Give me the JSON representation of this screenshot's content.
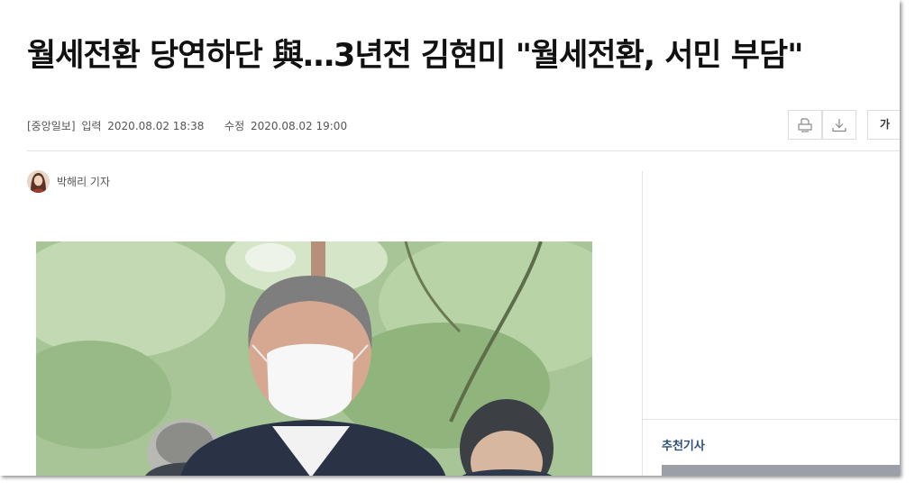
{
  "article": {
    "headline": "월세전환 당연하단 與…3년전 김현미 \"월세전환, 서민 부담\"",
    "source": "[중앙일보]",
    "input_label": "입력",
    "input_time": "2020.08.02 18:38",
    "edit_label": "수정",
    "edit_time": "2020.08.02 19:00",
    "reporter": "박해리 기자"
  },
  "toolbar": {
    "print_icon": "print-icon",
    "download_icon": "download-icon",
    "font_size_label": "가"
  },
  "sidebar": {
    "recommended_title": "추천기사"
  }
}
